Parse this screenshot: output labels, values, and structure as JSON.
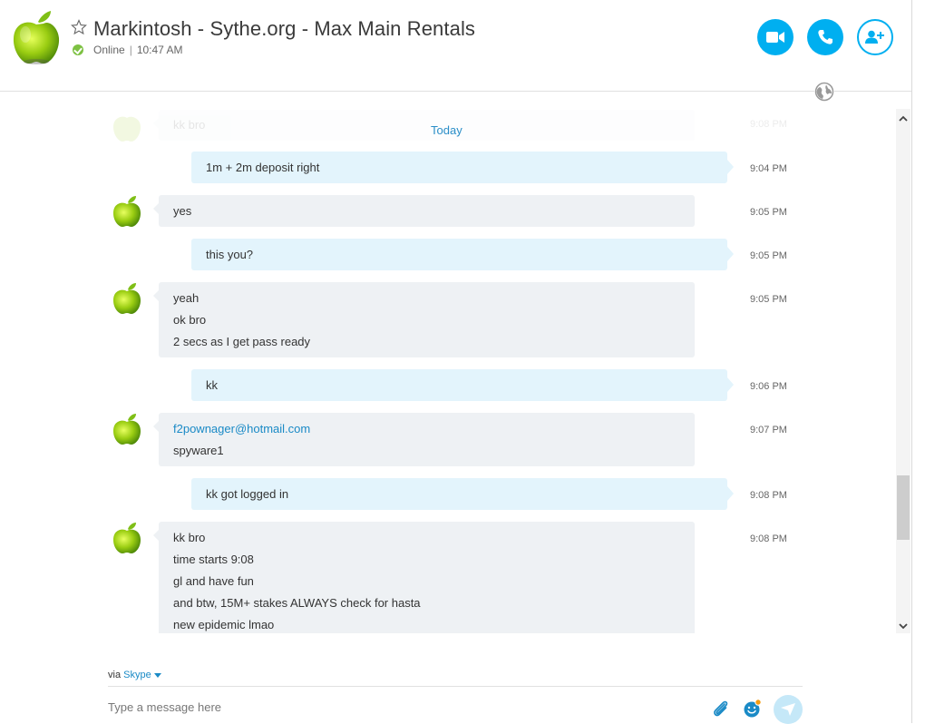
{
  "header": {
    "title": "Markintosh - Sythe.org - Max Main Rentals",
    "status": "Online",
    "time": "10:47 AM"
  },
  "chat": {
    "date_divider": "Today",
    "ghost_message": {
      "text": "kk bro",
      "time": "9:08 PM"
    },
    "messages": [
      {
        "direction": "out",
        "lines": [
          "1m + 2m deposit right"
        ],
        "time": "9:04 PM"
      },
      {
        "direction": "in",
        "lines": [
          "yes"
        ],
        "time": "9:05 PM"
      },
      {
        "direction": "out",
        "lines": [
          "this you?"
        ],
        "time": "9:05 PM"
      },
      {
        "direction": "in",
        "lines": [
          "yeah",
          "ok bro",
          "2 secs as I get pass ready"
        ],
        "time": "9:05 PM"
      },
      {
        "direction": "out",
        "lines": [
          "kk"
        ],
        "time": "9:06 PM"
      },
      {
        "direction": "in",
        "lines": [
          "f2pownager@hotmail.com",
          "spyware1"
        ],
        "time": "9:07 PM"
      },
      {
        "direction": "out",
        "lines": [
          "kk got logged in"
        ],
        "time": "9:08 PM"
      },
      {
        "direction": "in",
        "lines": [
          "kk bro",
          "time starts 9:08",
          "gl and have fun",
          "and btw, 15M+ stakes ALWAYS check for hasta",
          "new epidemic lmao"
        ],
        "time": "9:08 PM"
      }
    ]
  },
  "compose": {
    "via_label": "via",
    "via_service": "Skype",
    "placeholder": "Type a message here"
  },
  "colors": {
    "accent": "#00aff0",
    "incoming_bubble": "#eef1f4",
    "outgoing_bubble": "#e3f4fc",
    "online": "#7dc142",
    "link": "#1a8ac6"
  },
  "icons": [
    "apple-avatar",
    "star-icon",
    "status-online-icon",
    "video-call-icon",
    "phone-icon",
    "add-contact-icon",
    "globe-icon",
    "scroll-up-icon",
    "scroll-down-icon",
    "chevron-down-icon",
    "attach-icon",
    "emoji-icon",
    "send-icon"
  ]
}
